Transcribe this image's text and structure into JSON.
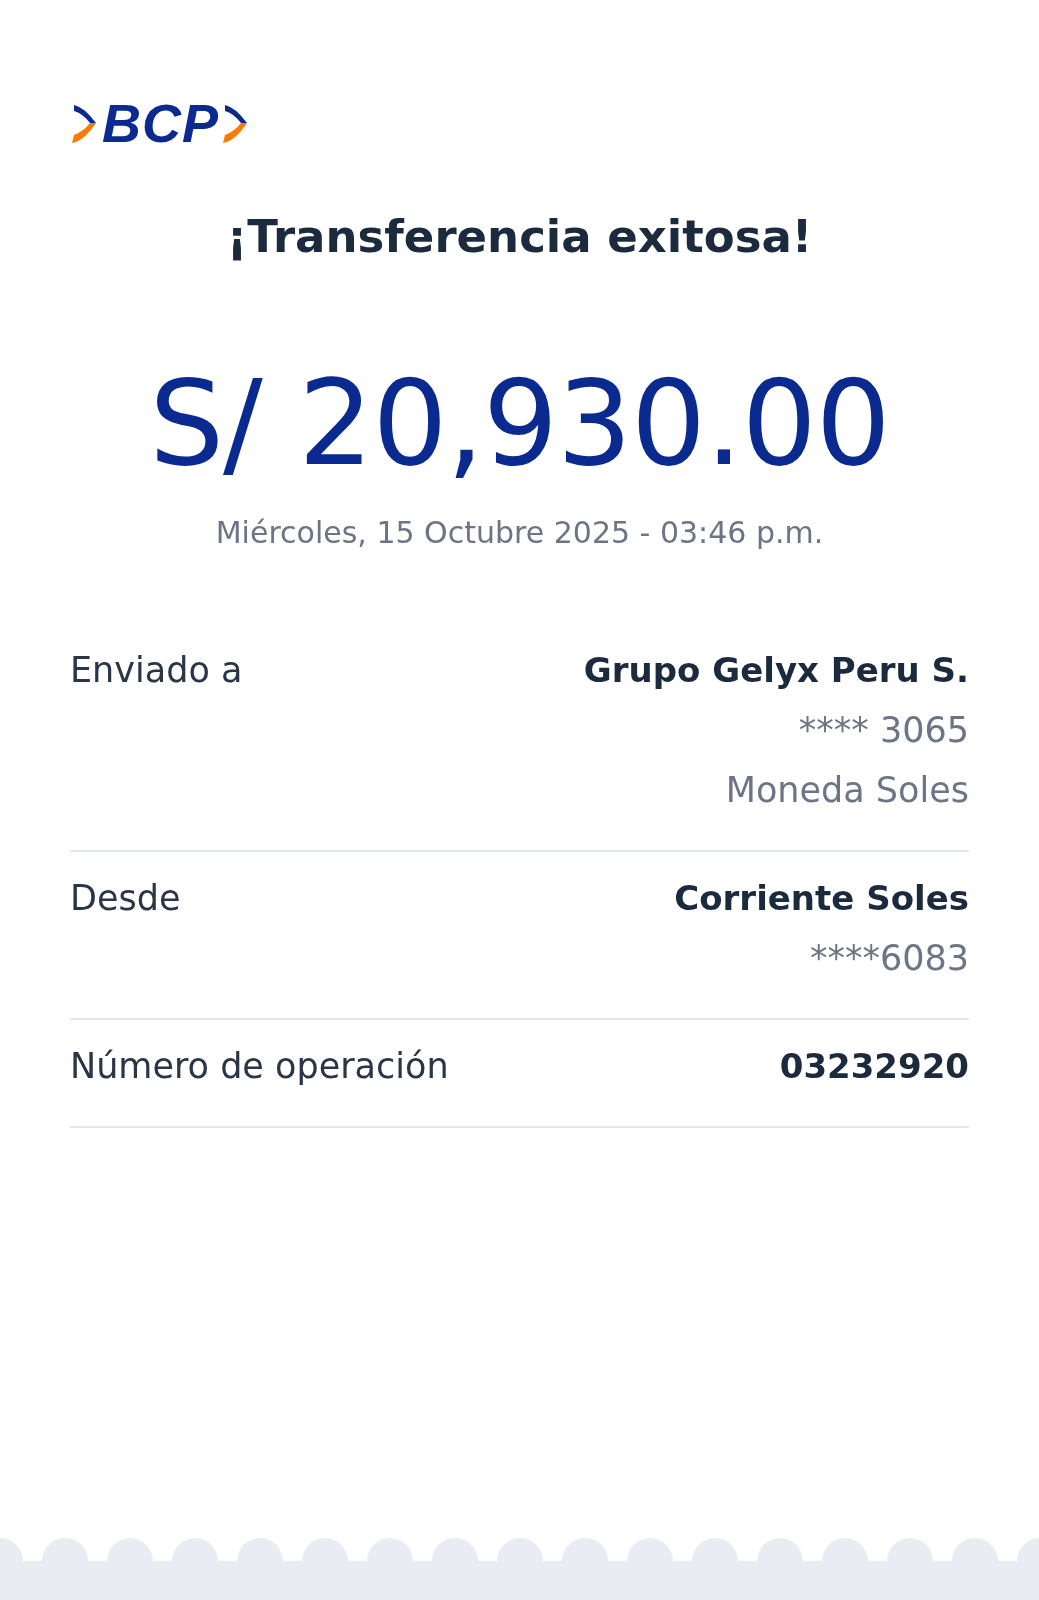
{
  "logo": {
    "text": "BCP"
  },
  "title": "¡Transferencia exitosa!",
  "amount": "S/ 20,930.00",
  "date": "Miércoles, 15 Octubre 2025 - 03:46 p.m.",
  "details": [
    {
      "label": "Enviado a",
      "lines": [
        {
          "text": "Grupo Gelyx Peru S.",
          "kind": "strong"
        },
        {
          "text": "**** 3065",
          "kind": "muted"
        },
        {
          "text": "Moneda Soles",
          "kind": "muted"
        }
      ]
    },
    {
      "label": "Desde",
      "lines": [
        {
          "text": "Corriente Soles",
          "kind": "strong"
        },
        {
          "text": "****6083",
          "kind": "muted"
        }
      ]
    },
    {
      "label": "Número de operación",
      "lines": [
        {
          "text": "03232920",
          "kind": "strong"
        }
      ]
    }
  ]
}
